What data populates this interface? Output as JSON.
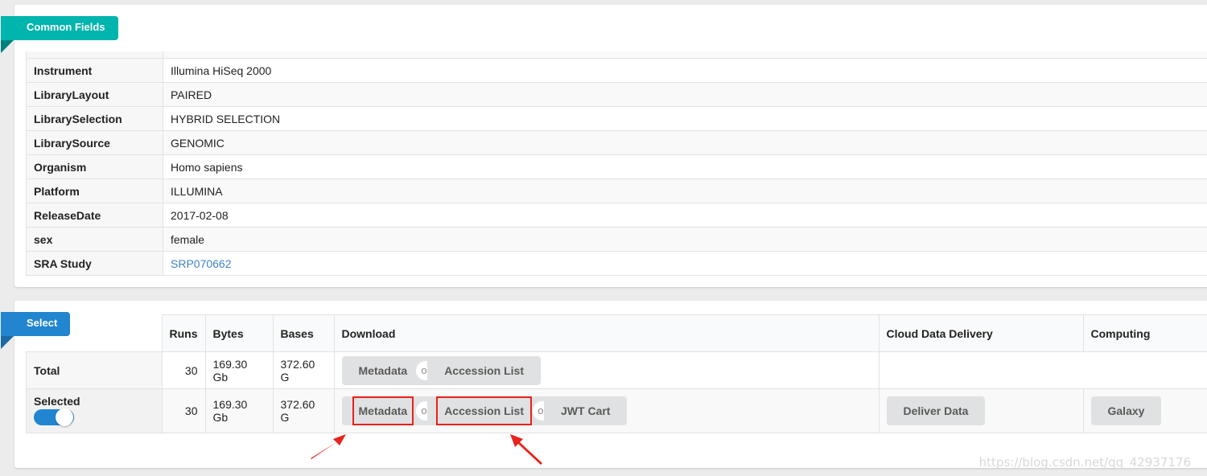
{
  "common_fields": {
    "title": "Common Fields",
    "rows": [
      {
        "key": "Instrument",
        "value": "Illumina HiSeq 2000"
      },
      {
        "key": "LibraryLayout",
        "value": "PAIRED"
      },
      {
        "key": "LibrarySelection",
        "value": "HYBRID SELECTION"
      },
      {
        "key": "LibrarySource",
        "value": "GENOMIC"
      },
      {
        "key": "Organism",
        "value": "Homo sapiens"
      },
      {
        "key": "Platform",
        "value": "ILLUMINA"
      },
      {
        "key": "ReleaseDate",
        "value": "2017-02-08"
      },
      {
        "key": "sex",
        "value": "female"
      },
      {
        "key": "SRA Study",
        "value": "SRP070662",
        "is_link": true
      }
    ]
  },
  "select": {
    "title": "Select",
    "headers": [
      "Runs",
      "Bytes",
      "Bases",
      "Download",
      "Cloud Data Delivery",
      "Computing"
    ],
    "total": {
      "label": "Total",
      "runs": "30",
      "bytes": "169.30 Gb",
      "bases": "372.60 G",
      "download": [
        "Metadata",
        "Accession List"
      ]
    },
    "selected": {
      "label": "Selected",
      "toggle_on": true,
      "runs": "30",
      "bytes": "169.30 Gb",
      "bases": "372.60 G",
      "download": [
        "Metadata",
        "Accession List",
        "JWT Cart"
      ],
      "cloud": "Deliver Data",
      "computing": "Galaxy"
    },
    "or_label": "or"
  },
  "annotation": {
    "highlight_color": "#e8221c",
    "highlighted": [
      "Metadata",
      "Accession List"
    ]
  },
  "watermark": "https://blog.csdn.net/qq_42937176",
  "colors": {
    "teal": "#00b5ad",
    "blue": "#2185d0",
    "link": "#4183c4"
  }
}
